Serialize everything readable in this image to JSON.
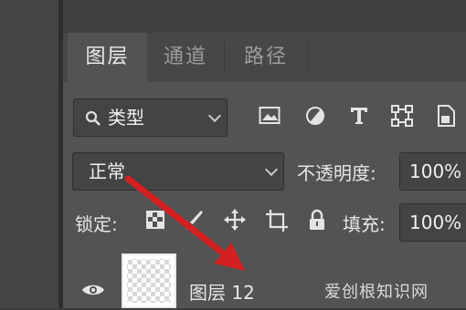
{
  "tabs": [
    {
      "label": "图层",
      "active": true
    },
    {
      "label": "通道",
      "active": false
    },
    {
      "label": "路径",
      "active": false
    }
  ],
  "filter": {
    "kind_label": "类型",
    "icons": [
      "image-icon",
      "adjustment-icon",
      "type-icon",
      "shape-icon",
      "smart-object-icon"
    ]
  },
  "blend": {
    "mode": "正常",
    "opacity_label": "不透明度:",
    "opacity_value": "100%"
  },
  "lock": {
    "label": "锁定:",
    "fill_label": "填充:",
    "fill_value": "100%"
  },
  "layer": {
    "name": "图层 12"
  },
  "watermark": "爱创根知识网",
  "colors": {
    "panel": "#535353",
    "arrow": "#d42020"
  }
}
